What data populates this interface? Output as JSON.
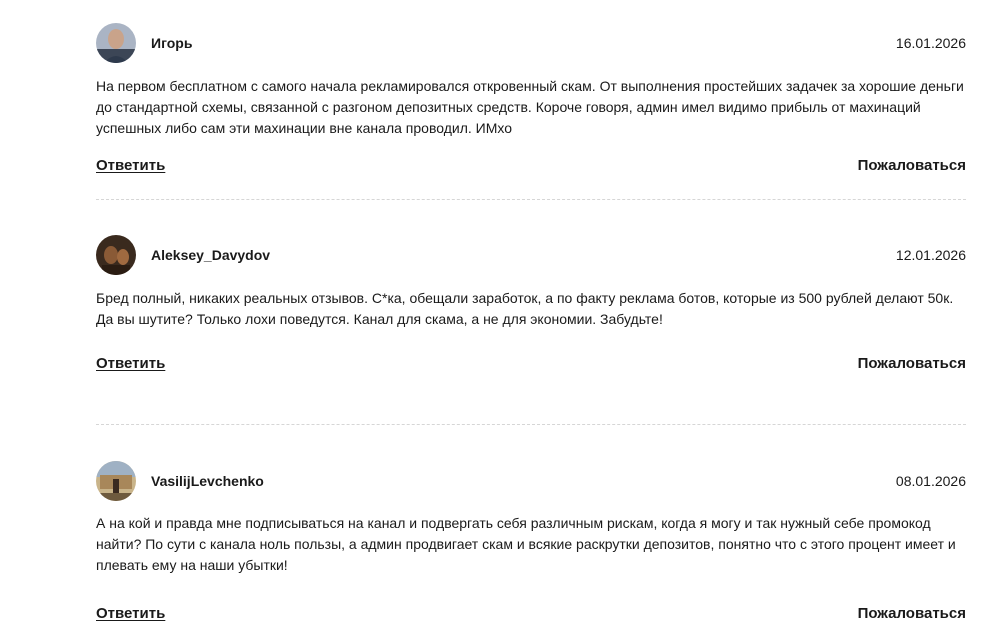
{
  "comments": [
    {
      "author": "Игорь",
      "date": "16.01.2026",
      "text": "На первом бесплатном с самого начала рекламировался откровенный скам. От выполнения простейших задачек за хорошие деньги до стандартной схемы, связанной с разгоном депозитных средств. Короче говоря, админ имел видимо прибыль от махинаций успешных либо сам эти махинации вне канала проводил. ИМхо",
      "reply_label": "Ответить",
      "report_label": "Пожаловаться"
    },
    {
      "author": "Aleksey_Davydov",
      "date": "12.01.2026",
      "text": "Бред полный, никаких реальных отзывов. С*ка, обещали заработок, а по факту реклама ботов, которые из 500 рублей делают 50к. Да вы шутите? Только лохи поведутся. Канал для скама, а не для экономии. Забудьте!",
      "reply_label": "Ответить",
      "report_label": "Пожаловаться"
    },
    {
      "author": "VasilijLevchenko",
      "date": "08.01.2026",
      "text": "А на кой и правда мне подписываться на канал и подвергать себя различным рискам, когда я могу и так нужный себе промокод найти? По сути с канала ноль пользы, а админ продвигает скам и всякие раскрутки депозитов, понятно что с этого процент имеет и плевать ему на наши убытки!",
      "reply_label": "Ответить",
      "report_label": "Пожаловаться"
    }
  ],
  "colors": {
    "text": "#1a1a1a",
    "divider": "#d6d6d6",
    "background": "#ffffff"
  }
}
